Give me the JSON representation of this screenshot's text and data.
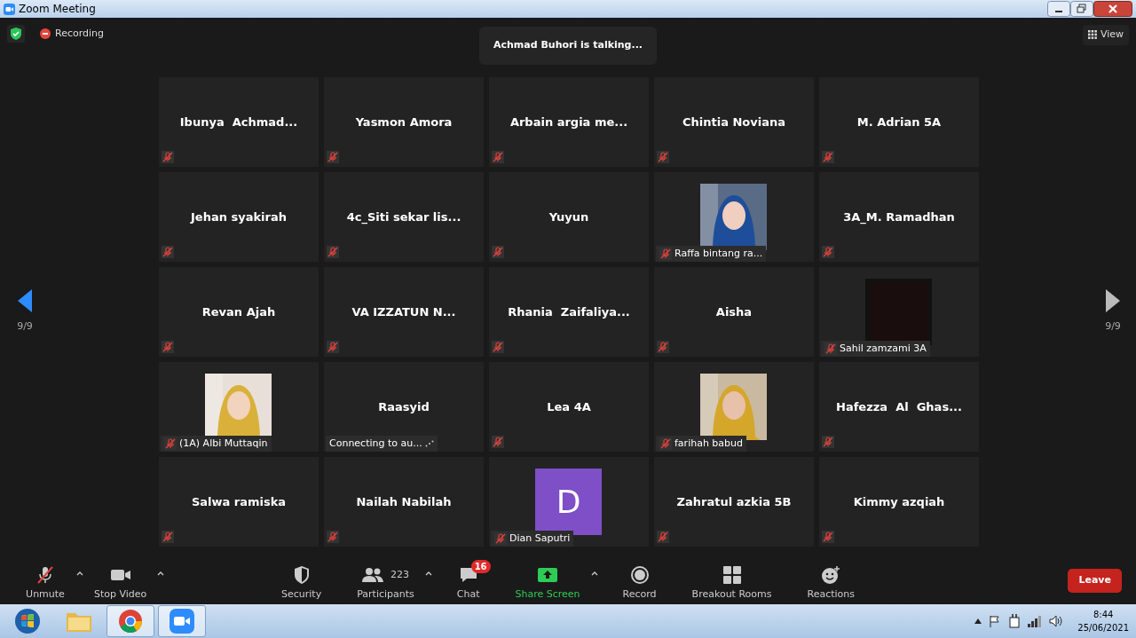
{
  "window": {
    "title": "Zoom Meeting"
  },
  "top_bar": {
    "recording": "Recording",
    "talking": "Achmad Buhori is talking...",
    "view": "View"
  },
  "pager": {
    "left": "9/9",
    "right": "9/9"
  },
  "tiles": [
    {
      "kind": "name",
      "name": "Ibunya  Achmad...",
      "muted": true
    },
    {
      "kind": "name",
      "name": "Yasmon Amora",
      "muted": true
    },
    {
      "kind": "name",
      "name": "Arbain argia me...",
      "muted": true
    },
    {
      "kind": "name",
      "name": "Chintia Noviana",
      "muted": true
    },
    {
      "kind": "name",
      "name": "M. Adrian 5A",
      "muted": true
    },
    {
      "kind": "name",
      "name": "Jehan syakirah",
      "muted": true
    },
    {
      "kind": "name",
      "name": "4c_Siti sekar lis...",
      "muted": true
    },
    {
      "kind": "name",
      "name": "Yuyun",
      "muted": true
    },
    {
      "kind": "video",
      "name": "Raffa bintang ra...",
      "muted": true
    },
    {
      "kind": "name",
      "name": "3A_M. Ramadhan",
      "muted": true
    },
    {
      "kind": "name",
      "name": "Revan Ajah",
      "muted": true
    },
    {
      "kind": "name",
      "name": "VA IZZATUN N...",
      "muted": true
    },
    {
      "kind": "name",
      "name": "Rhania  Zaifaliya...",
      "muted": true
    },
    {
      "kind": "name",
      "name": "Aisha",
      "muted": true
    },
    {
      "kind": "video",
      "name": "Sahil zamzami 3A",
      "muted": true
    },
    {
      "kind": "video",
      "name": "(1A) Albi Muttaqin",
      "muted": true
    },
    {
      "kind": "name",
      "name": "Raasyid",
      "status": "Connecting to au...",
      "muted": false
    },
    {
      "kind": "name",
      "name": "Lea 4A",
      "muted": true
    },
    {
      "kind": "video",
      "name": "farihah babud",
      "muted": true
    },
    {
      "kind": "name",
      "name": "Hafezza  Al  Ghas...",
      "muted": true
    },
    {
      "kind": "name",
      "name": "Salwa ramiska",
      "muted": true
    },
    {
      "kind": "name",
      "name": "Nailah Nabilah",
      "muted": true
    },
    {
      "kind": "avatar",
      "name": "Dian Saputri",
      "letter": "D",
      "color": "#7e4fc6",
      "muted": true
    },
    {
      "kind": "name",
      "name": "Zahratul azkia 5B",
      "muted": true
    },
    {
      "kind": "name",
      "name": "Kimmy azqiah",
      "muted": true
    }
  ],
  "toolbar": {
    "left": [
      {
        "kind": "mic",
        "label": "Unmute",
        "caret": true
      },
      {
        "kind": "video",
        "label": "Stop Video",
        "caret": true
      }
    ],
    "center": [
      {
        "kind": "security",
        "label": "Security"
      },
      {
        "kind": "participants",
        "label": "Participants",
        "count": "223",
        "caret": true
      },
      {
        "kind": "chat",
        "label": "Chat",
        "badge": "16"
      },
      {
        "kind": "share",
        "label": "Share Screen",
        "caret": true
      },
      {
        "kind": "record",
        "label": "Record"
      },
      {
        "kind": "breakout",
        "label": "Breakout Rooms"
      },
      {
        "kind": "reactions",
        "label": "Reactions"
      }
    ],
    "leave": "Leave"
  },
  "taskbar": {
    "apps": [
      {
        "kind": "start",
        "active": false
      },
      {
        "kind": "folder",
        "active": false
      },
      {
        "kind": "chrome",
        "active": true
      },
      {
        "kind": "zoom",
        "active": true
      }
    ],
    "time": "8:44",
    "date": "25/06/2021"
  }
}
